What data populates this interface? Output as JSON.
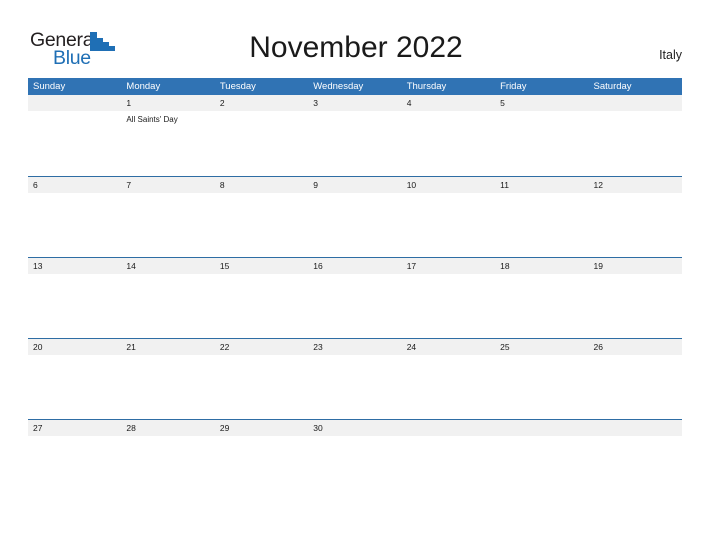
{
  "brand": {
    "name_part1": "General",
    "name_part2": "Blue",
    "triangle_color": "#1f6fb5",
    "text_color": "#231f20"
  },
  "header": {
    "title": "November 2022",
    "country": "Italy"
  },
  "theme": {
    "header_blue": "#3073b4",
    "row_line_blue": "#2e6da4",
    "band_gray": "#f1f1f1",
    "text": "#1a1a1a"
  },
  "calendar": {
    "weekdays": [
      "Sunday",
      "Monday",
      "Tuesday",
      "Wednesday",
      "Thursday",
      "Friday",
      "Saturday"
    ],
    "weeks": [
      {
        "days": [
          {
            "date": "",
            "events": []
          },
          {
            "date": "1",
            "events": [
              "All Saints' Day"
            ]
          },
          {
            "date": "2",
            "events": []
          },
          {
            "date": "3",
            "events": []
          },
          {
            "date": "4",
            "events": []
          },
          {
            "date": "5",
            "events": []
          },
          {
            "date": "",
            "events": []
          }
        ]
      },
      {
        "days": [
          {
            "date": "6",
            "events": []
          },
          {
            "date": "7",
            "events": []
          },
          {
            "date": "8",
            "events": []
          },
          {
            "date": "9",
            "events": []
          },
          {
            "date": "10",
            "events": []
          },
          {
            "date": "11",
            "events": []
          },
          {
            "date": "12",
            "events": []
          }
        ]
      },
      {
        "days": [
          {
            "date": "13",
            "events": []
          },
          {
            "date": "14",
            "events": []
          },
          {
            "date": "15",
            "events": []
          },
          {
            "date": "16",
            "events": []
          },
          {
            "date": "17",
            "events": []
          },
          {
            "date": "18",
            "events": []
          },
          {
            "date": "19",
            "events": []
          }
        ]
      },
      {
        "days": [
          {
            "date": "20",
            "events": []
          },
          {
            "date": "21",
            "events": []
          },
          {
            "date": "22",
            "events": []
          },
          {
            "date": "23",
            "events": []
          },
          {
            "date": "24",
            "events": []
          },
          {
            "date": "25",
            "events": []
          },
          {
            "date": "26",
            "events": []
          }
        ]
      },
      {
        "days": [
          {
            "date": "27",
            "events": []
          },
          {
            "date": "28",
            "events": []
          },
          {
            "date": "29",
            "events": []
          },
          {
            "date": "30",
            "events": []
          },
          {
            "date": "",
            "events": []
          },
          {
            "date": "",
            "events": []
          },
          {
            "date": "",
            "events": []
          }
        ]
      }
    ]
  }
}
